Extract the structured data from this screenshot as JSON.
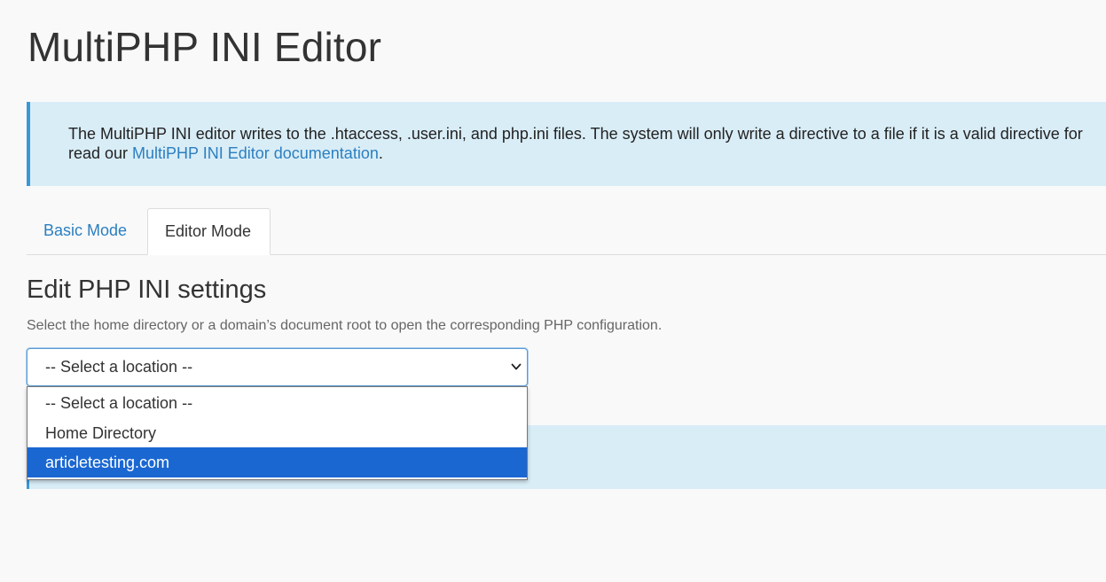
{
  "page": {
    "title": "MultiPHP INI Editor"
  },
  "info_banner": {
    "line1": "The MultiPHP INI editor writes to the .htaccess, .user.ini, and php.ini files. The system will only write a directive to a file if it is a valid directive for",
    "line2_prefix": "read our ",
    "link_text": "MultiPHP INI Editor documentation",
    "line2_suffix": "."
  },
  "tabs": [
    {
      "label": "Basic Mode",
      "active": false
    },
    {
      "label": "Editor Mode",
      "active": true
    }
  ],
  "editor": {
    "heading": "Edit PHP INI settings",
    "description": "Select the home directory or a domain’s document root to open the corresponding PHP configuration.",
    "location_select": {
      "value": "-- Select a location --",
      "options": [
        {
          "label": "-- Select a location --",
          "highlighted": false
        },
        {
          "label": "Home Directory",
          "highlighted": false
        },
        {
          "label": "articletesting.com",
          "highlighted": true
        }
      ]
    }
  },
  "colors": {
    "accent": "#3a97d8",
    "link": "#2b7fc0",
    "banner_bg": "#d9edf7",
    "option_highlight": "#1a67d2"
  },
  "icons": {
    "select_toggle": "chevron-down-icon"
  }
}
